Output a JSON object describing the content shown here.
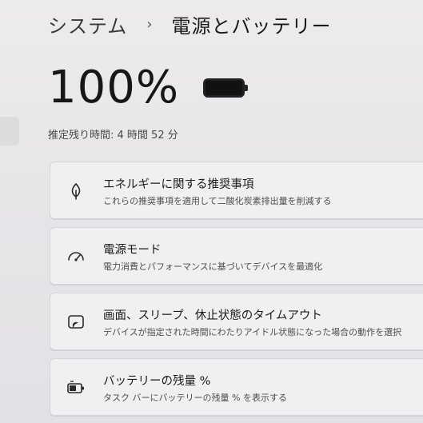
{
  "breadcrumb": {
    "parent": "システム",
    "separator": "›",
    "current": "電源とバッテリー"
  },
  "battery": {
    "percent_text": "100%",
    "level": 1.0,
    "icon": "battery-full-icon",
    "remaining_text": "推定残り時間: 4 時間 52 分"
  },
  "cards": [
    {
      "icon": "leaf-icon",
      "title": "エネルギーに関する推奨事項",
      "description": "これらの推奨事項を適用して二酸化炭素排出量を削減する"
    },
    {
      "icon": "power-mode-gauge-icon",
      "title": "電源モード",
      "description": "電力消費とパフォーマンスに基づいてデバイスを最適化"
    },
    {
      "icon": "screen-sleep-icon",
      "title": "画面、スリープ、休止状態のタイムアウト",
      "description": "デバイスが指定された時間にわたりアイドル状態になった場合の動作を選択"
    },
    {
      "icon": "battery-saver-icon",
      "title": "バッテリーの残量 %",
      "description": "タスク バーにバッテリーの残量 % を表示する"
    }
  ],
  "colors": {
    "background": "#e8e7ea",
    "card": "#f0eff2",
    "text": "#1e1e1e"
  }
}
